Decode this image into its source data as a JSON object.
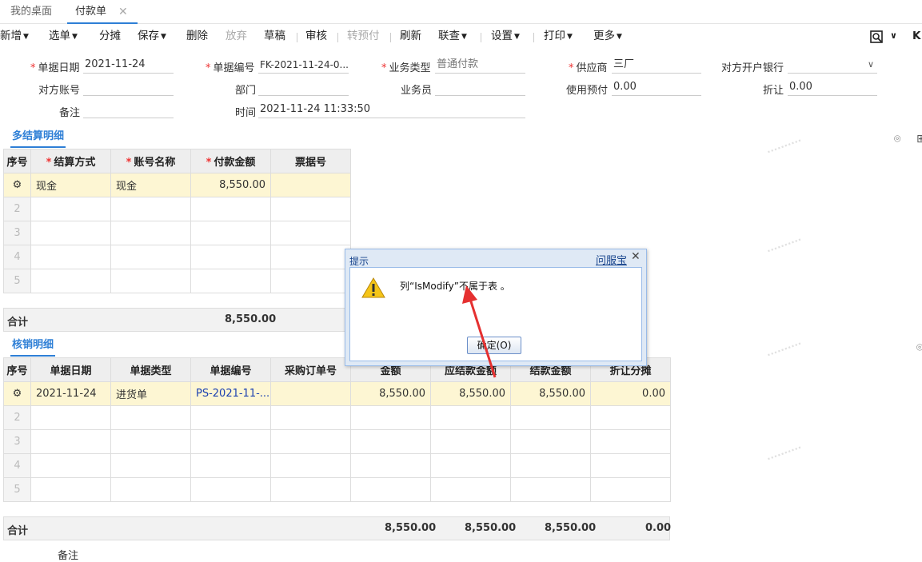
{
  "tabs": {
    "home": "我的桌面",
    "active": "付款单",
    "close": "✕"
  },
  "toolbar": {
    "add": "新增",
    "select": "选单",
    "allocate": "分摊",
    "save": "保存",
    "delete": "删除",
    "discard": "放弃",
    "draft": "草稿",
    "audit": "审核",
    "to_prepay": "转预付",
    "refresh": "刷新",
    "link_query": "联查",
    "settings": "设置",
    "print": "打印",
    "more": "更多"
  },
  "form": {
    "date_label": "单据日期",
    "date_value": "2021-11-24",
    "no_label": "单据编号",
    "no_value": "FK-2021-11-24-0...",
    "biztype_label": "业务类型",
    "biztype_value": "普通付款",
    "supplier_label": "供应商",
    "supplier_value": "三厂",
    "bank_label": "对方开户银行",
    "bank_value": "",
    "account_label": "对方账号",
    "account_value": "",
    "dept_label": "部门",
    "dept_value": "",
    "staff_label": "业务员",
    "staff_value": "",
    "prepay_label": "使用预付",
    "prepay_value": "0.00",
    "discount_label": "折让",
    "discount_value": "0.00",
    "remark_label": "备注",
    "remark_value": "",
    "time_label": "时间",
    "time_value": "2021-11-24 11:33:50"
  },
  "settle": {
    "title": "多结算明细",
    "headers": [
      "序号",
      "结算方式",
      "账号名称",
      "付款金额",
      "票据号"
    ],
    "rows": [
      [
        "",
        "现金",
        "现金",
        "8,550.00",
        ""
      ],
      [
        "2",
        "",
        "",
        "",
        ""
      ],
      [
        "3",
        "",
        "",
        "",
        ""
      ],
      [
        "4",
        "",
        "",
        "",
        ""
      ],
      [
        "5",
        "",
        "",
        "",
        ""
      ]
    ],
    "total_label": "合计",
    "total_value": "8,550.00"
  },
  "verify": {
    "title": "核销明细",
    "headers": [
      "序号",
      "单据日期",
      "单据类型",
      "单据编号",
      "采购订单号",
      "金额",
      "应结款金额",
      "结款金额",
      "折让分摊"
    ],
    "rows": [
      [
        "",
        "2021-11-24",
        "进货单",
        "PS-2021-11-...",
        "",
        "8,550.00",
        "8,550.00",
        "8,550.00",
        "0.00"
      ],
      [
        "2",
        "",
        "",
        "",
        "",
        "",
        "",
        "",
        ""
      ],
      [
        "3",
        "",
        "",
        "",
        "",
        "",
        "",
        "",
        ""
      ],
      [
        "4",
        "",
        "",
        "",
        "",
        "",
        "",
        "",
        ""
      ],
      [
        "5",
        "",
        "",
        "",
        "",
        "",
        "",
        "",
        ""
      ]
    ],
    "total_label": "合计",
    "totals": [
      "8,550.00",
      "8,550.00",
      "8,550.00",
      "0.00"
    ],
    "bottom_remark": "备注"
  },
  "dialog": {
    "title": "提示",
    "help": "问服宝",
    "message": "列“IsModify”不属于表 。",
    "ok": "确定(O)"
  },
  "colors": {
    "accent": "#2e7fd6",
    "selected_row": "#fdf6d3",
    "required": "#e33333",
    "arrow": "#e53030"
  }
}
